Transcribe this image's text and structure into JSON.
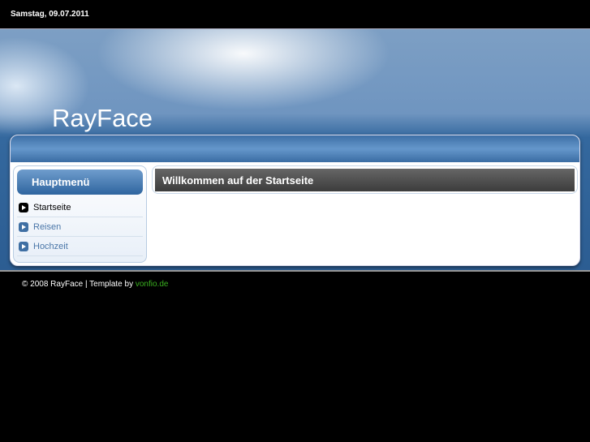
{
  "header": {
    "date": "Samstag, 09.07.2011",
    "site_title": "RayFace"
  },
  "sidebar": {
    "title": "Hauptmenü",
    "items": [
      {
        "label": "Startseite"
      },
      {
        "label": "Reisen"
      },
      {
        "label": "Hochzeit"
      }
    ]
  },
  "main": {
    "heading": "Willkommen auf der Startseite"
  },
  "footer": {
    "text": "© 2008 RayFace | Template by ",
    "link": "vonfio.de"
  },
  "colors": {
    "accent": "#3f6fa3",
    "link": "#3ab020"
  }
}
